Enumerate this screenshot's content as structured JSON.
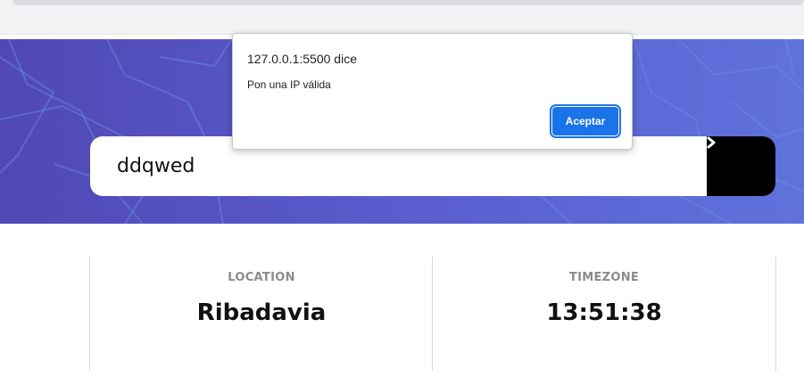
{
  "search": {
    "value": "ddqwed",
    "submit_icon": "chevron-right-icon"
  },
  "info": {
    "location": {
      "label": "LOCATION",
      "value": "Ribadavia"
    },
    "timezone": {
      "label": "TIMEZONE",
      "value": "13:51:38"
    }
  },
  "alert_dialog": {
    "title": "127.0.0.1:5500 dice",
    "message": "Pon una IP válida",
    "ok_label": "Aceptar"
  },
  "colors": {
    "hero_gradient_start": "#5048b4",
    "hero_gradient_end": "#5f72dc",
    "dialog_button": "#1a73e8",
    "search_button": "#000000"
  }
}
